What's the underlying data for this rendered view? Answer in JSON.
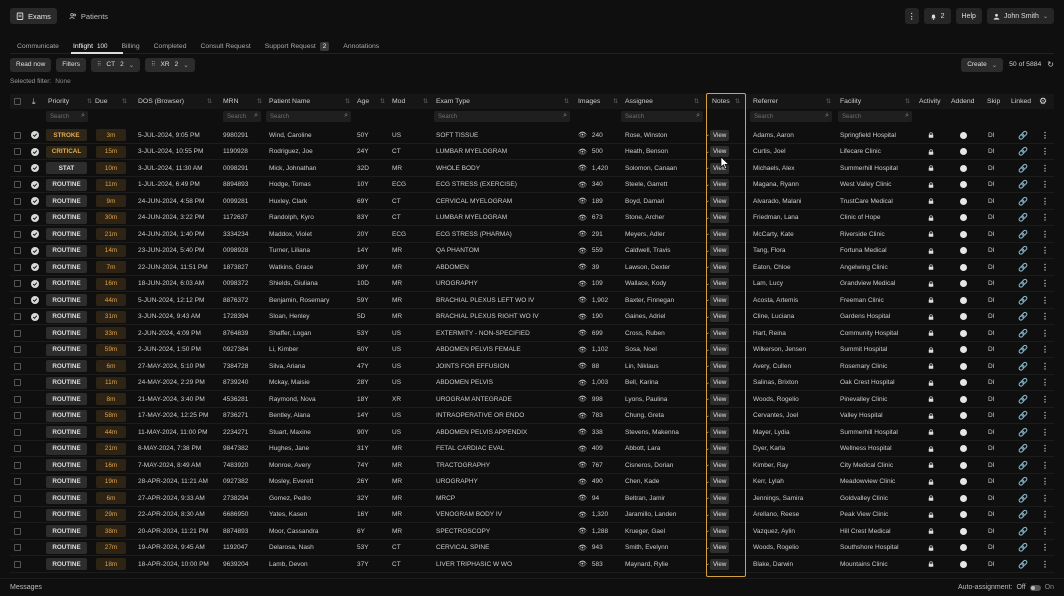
{
  "nav": {
    "exams": "Exams",
    "patients": "Patients",
    "notifications": "2",
    "help": "Help",
    "user": "John Smith"
  },
  "tabs": [
    {
      "label": "Communicate",
      "count": ""
    },
    {
      "label": "Inflight",
      "count": "100"
    },
    {
      "label": "Billing",
      "count": ""
    },
    {
      "label": "Completed",
      "count": ""
    },
    {
      "label": "Consult Request",
      "count": ""
    },
    {
      "label": "Support Request",
      "count": "2"
    },
    {
      "label": "Annotations",
      "count": ""
    }
  ],
  "filters": {
    "read_now": "Read now",
    "filters": "Filters",
    "chip1_label": "CT",
    "chip1_count": "2",
    "chip2_label": "XR",
    "chip2_count": "2",
    "create": "Create",
    "count_text": "50 of 5884",
    "selected_filter_label": "Selected filter:",
    "selected_filter_value": "None"
  },
  "columns": {
    "priority": "Priority",
    "due": "Due",
    "dos": "DOS (Browser)",
    "mrn": "MRN",
    "patient": "Patient Name",
    "age": "Age",
    "mod": "Mod",
    "exam": "Exam Type",
    "images": "Images",
    "assignee": "Assignee",
    "notes": "Notes",
    "referrer": "Referrer",
    "facility": "Facility",
    "activity": "Activity",
    "addend": "Addend",
    "skip": "Skip",
    "linked": "Linked",
    "search": "Search"
  },
  "view_label": "View",
  "skip_label": "DI",
  "rows": [
    {
      "checked": true,
      "priority": "STROKE",
      "due": "3m",
      "dos": "5-JUL-2024, 9:05 PM",
      "mrn": "9980291",
      "patient": "Wind, Caroline",
      "age": "50Y",
      "mod": "US",
      "exam": "SOFT TISSUE",
      "images": "240",
      "assignee": "Rose, Winston",
      "referrer": "Adams, Aaron",
      "facility": "Springfield Hospital"
    },
    {
      "checked": true,
      "priority": "CRITICAL",
      "due": "15m",
      "dos": "3-JUL-2024, 10:55 PM",
      "mrn": "1190928",
      "patient": "Rodriguez, Joe",
      "age": "24Y",
      "mod": "CT",
      "exam": "LUMBAR MYELOGRAM",
      "images": "500",
      "assignee": "Heath, Benson",
      "referrer": "Curtis, Joel",
      "facility": "Lifecare Clinic"
    },
    {
      "checked": true,
      "priority": "STAT",
      "due": "10m",
      "dos": "3-JUL-2024, 11:30 AM",
      "mrn": "0098291",
      "patient": "Mick, Johnathan",
      "age": "32D",
      "mod": "MR",
      "exam": "WHOLE BODY",
      "images": "1,420",
      "assignee": "Solomon, Canaan",
      "referrer": "Michaels, Alex",
      "facility": "Summerhill Hospital"
    },
    {
      "checked": true,
      "priority": "ROUTINE",
      "due": "11m",
      "dos": "1-JUL-2024, 6:49 PM",
      "mrn": "8894893",
      "patient": "Hodge, Tomas",
      "age": "10Y",
      "mod": "ECG",
      "exam": "ECG STRESS (EXERCISE)",
      "images": "340",
      "assignee": "Steele, Garrett",
      "referrer": "Magana, Ryann",
      "facility": "West Valley Clinic"
    },
    {
      "checked": true,
      "priority": "ROUTINE",
      "due": "9m",
      "dos": "24-JUN-2024, 4:58 PM",
      "mrn": "0099281",
      "patient": "Huxley, Clark",
      "age": "69Y",
      "mod": "CT",
      "exam": "CERVICAL MYELOGRAM",
      "images": "189",
      "assignee": "Boyd, Damari",
      "referrer": "Alvarado, Malani",
      "facility": "TrustCare Medical"
    },
    {
      "checked": true,
      "priority": "ROUTINE",
      "due": "30m",
      "dos": "24-JUN-2024, 3:22 PM",
      "mrn": "1172637",
      "patient": "Randolph, Kyro",
      "age": "83Y",
      "mod": "CT",
      "exam": "LUMBAR MYELOGRAM",
      "images": "673",
      "assignee": "Stone, Archer",
      "referrer": "Friedman, Lana",
      "facility": "Clinic of Hope"
    },
    {
      "checked": true,
      "priority": "ROUTINE",
      "due": "21m",
      "dos": "24-JUN-2024, 1:40 PM",
      "mrn": "3334234",
      "patient": "Maddox, Violet",
      "age": "20Y",
      "mod": "ECG",
      "exam": "ECG STRESS (PHARMA)",
      "images": "291",
      "assignee": "Meyers, Adler",
      "referrer": "McCarty, Kate",
      "facility": "Riverside Clinic"
    },
    {
      "checked": true,
      "priority": "ROUTINE",
      "due": "14m",
      "dos": "23-JUN-2024, 5:40 PM",
      "mrn": "0098928",
      "patient": "Turner, Liliana",
      "age": "14Y",
      "mod": "MR",
      "exam": "QA PHANTOM",
      "images": "559",
      "assignee": "Caldwell, Travis",
      "referrer": "Tang, Flora",
      "facility": "Fortuna Medical"
    },
    {
      "checked": true,
      "priority": "ROUTINE",
      "due": "7m",
      "dos": "22-JUN-2024, 11:51 PM",
      "mrn": "1873827",
      "patient": "Watkins, Grace",
      "age": "39Y",
      "mod": "MR",
      "exam": "ABDOMEN",
      "images": "39",
      "assignee": "Lawson, Dexter",
      "referrer": "Eaton, Chloe",
      "facility": "Angelwing Clinic"
    },
    {
      "checked": true,
      "priority": "ROUTINE",
      "due": "16m",
      "dos": "18-JUN-2024, 6:03 AM",
      "mrn": "0098372",
      "patient": "Shields, Giuliana",
      "age": "10D",
      "mod": "MR",
      "exam": "UROGRAPHY",
      "images": "109",
      "assignee": "Wallace, Kody",
      "referrer": "Lam, Lucy",
      "facility": "Grandview Medical"
    },
    {
      "checked": true,
      "priority": "ROUTINE",
      "due": "44m",
      "dos": "5-JUN-2024, 12:12 PM",
      "mrn": "8876372",
      "patient": "Benjamin, Rosemary",
      "age": "59Y",
      "mod": "MR",
      "exam": "BRACHIAL PLEXUS LEFT WO IV",
      "images": "1,902",
      "assignee": "Baxter, Finnegan",
      "referrer": "Acosta, Artemis",
      "facility": "Freeman Clinic"
    },
    {
      "checked": true,
      "priority": "ROUTINE",
      "due": "31m",
      "dos": "3-JUN-2024, 9:43 AM",
      "mrn": "1728394",
      "patient": "Sloan, Henley",
      "age": "5D",
      "mod": "MR",
      "exam": "BRACHIAL PLEXUS RIGHT WO IV",
      "images": "190",
      "assignee": "Gaines, Adriel",
      "referrer": "Cline, Luciana",
      "facility": "Gardens Hospital"
    },
    {
      "checked": false,
      "priority": "ROUTINE",
      "due": "33m",
      "dos": "2-JUN-2024, 4:09 PM",
      "mrn": "8764839",
      "patient": "Shaffer, Logan",
      "age": "53Y",
      "mod": "US",
      "exam": "EXTERMITY - NON-SPECIFIED",
      "images": "699",
      "assignee": "Cross, Ruben",
      "referrer": "Hart, Reina",
      "facility": "Community Hospital"
    },
    {
      "checked": false,
      "priority": "ROUTINE",
      "due": "59m",
      "dos": "2-JUN-2024, 1:50 PM",
      "mrn": "0927384",
      "patient": "Li, Kimber",
      "age": "60Y",
      "mod": "US",
      "exam": "ABDOMEN PELVIS FEMALE",
      "images": "1,102",
      "assignee": "Sosa, Noel",
      "referrer": "Wilkerson, Jensen",
      "facility": "Summit Hospital"
    },
    {
      "checked": false,
      "priority": "ROUTINE",
      "due": "6m",
      "dos": "27-MAY-2024, 5:10 PM",
      "mrn": "7384728",
      "patient": "Silva, Ariana",
      "age": "47Y",
      "mod": "US",
      "exam": "JOINTS FOR EFFUSION",
      "images": "88",
      "assignee": "Lin, Niklaus",
      "referrer": "Avery, Cullen",
      "facility": "Rosemary Clinic"
    },
    {
      "checked": false,
      "priority": "ROUTINE",
      "due": "11m",
      "dos": "24-MAY-2024, 2:29 PM",
      "mrn": "8739240",
      "patient": "Mckay, Maisie",
      "age": "28Y",
      "mod": "US",
      "exam": "ABDOMEN PELVIS",
      "images": "1,003",
      "assignee": "Bell, Karina",
      "referrer": "Salinas, Brixton",
      "facility": "Oak Crest Hospital"
    },
    {
      "checked": false,
      "priority": "ROUTINE",
      "due": "8m",
      "dos": "21-MAY-2024, 3:40 PM",
      "mrn": "4536281",
      "patient": "Raymond, Nova",
      "age": "18Y",
      "mod": "XR",
      "exam": "UROGRAM ANTEGRADE",
      "images": "998",
      "assignee": "Lyons, Paulina",
      "referrer": "Woods, Rogelio",
      "facility": "Pinevalley Clinic"
    },
    {
      "checked": false,
      "priority": "ROUTINE",
      "due": "58m",
      "dos": "17-MAY-2024, 12:25 PM",
      "mrn": "8736271",
      "patient": "Bentley, Alana",
      "age": "14Y",
      "mod": "US",
      "exam": "INTRAOPERATIVE OR ENDO",
      "images": "783",
      "assignee": "Chung, Greta",
      "referrer": "Cervantes, Joel",
      "facility": "Valley Hospital"
    },
    {
      "checked": false,
      "priority": "ROUTINE",
      "due": "44m",
      "dos": "11-MAY-2024, 11:00 PM",
      "mrn": "2234271",
      "patient": "Stuart, Maxine",
      "age": "90Y",
      "mod": "US",
      "exam": "ABDOMEN PELVIS APPENDIX",
      "images": "338",
      "assignee": "Stevens, Makenna",
      "referrer": "Mayer, Lydia",
      "facility": "Summerhill Hospital"
    },
    {
      "checked": false,
      "priority": "ROUTINE",
      "due": "21m",
      "dos": "8-MAY-2024, 7:38 PM",
      "mrn": "9847382",
      "patient": "Hughes, Jane",
      "age": "31Y",
      "mod": "MR",
      "exam": "FETAL CARDIAC EVAL",
      "images": "409",
      "assignee": "Abbott, Lara",
      "referrer": "Dyer, Karla",
      "facility": "Wellness Hospital"
    },
    {
      "checked": false,
      "priority": "ROUTINE",
      "due": "16m",
      "dos": "7-MAY-2024, 8:49 AM",
      "mrn": "7483920",
      "patient": "Monroe, Avery",
      "age": "74Y",
      "mod": "MR",
      "exam": "TRACTOGRAPHY",
      "images": "767",
      "assignee": "Cisneros, Dorian",
      "referrer": "Kimber, Ray",
      "facility": "City Medical Clinic"
    },
    {
      "checked": false,
      "priority": "ROUTINE",
      "due": "19m",
      "dos": "28-APR-2024, 11:21 AM",
      "mrn": "0927382",
      "patient": "Mosley, Everett",
      "age": "26Y",
      "mod": "MR",
      "exam": "UROGRAPHY",
      "images": "490",
      "assignee": "Chen, Kade",
      "referrer": "Kerr, Lylah",
      "facility": "Meadowview Clinic"
    },
    {
      "checked": false,
      "priority": "ROUTINE",
      "due": "6m",
      "dos": "27-APR-2024, 9:33 AM",
      "mrn": "2738294",
      "patient": "Gomez, Pedro",
      "age": "32Y",
      "mod": "MR",
      "exam": "MRCP",
      "images": "94",
      "assignee": "Beltran, Jamir",
      "referrer": "Jennings, Samira",
      "facility": "Goldvalley Clinic"
    },
    {
      "checked": false,
      "priority": "ROUTINE",
      "due": "29m",
      "dos": "22-APR-2024, 8:30 AM",
      "mrn": "6686950",
      "patient": "Yates, Kasen",
      "age": "16Y",
      "mod": "MR",
      "exam": "VENOGRAM BODY IV",
      "images": "1,320",
      "assignee": "Jaramillo, Landen",
      "referrer": "Arellano, Reese",
      "facility": "Peak View Clinic"
    },
    {
      "checked": false,
      "priority": "ROUTINE",
      "due": "38m",
      "dos": "20-APR-2024, 11:21 PM",
      "mrn": "8874893",
      "patient": "Moor, Cassandra",
      "age": "6Y",
      "mod": "MR",
      "exam": "SPECTROSCOPY",
      "images": "1,288",
      "assignee": "Krueger, Gael",
      "referrer": "Vazquez, Aylin",
      "facility": "Hill Crest Medical"
    },
    {
      "checked": false,
      "priority": "ROUTINE",
      "due": "27m",
      "dos": "19-APR-2024, 9:45 AM",
      "mrn": "1192047",
      "patient": "Delarosa, Nash",
      "age": "53Y",
      "mod": "CT",
      "exam": "CERVICAL SPINE",
      "images": "943",
      "assignee": "Smith, Evelynn",
      "referrer": "Woods, Rogelio",
      "facility": "Southshore Hospital"
    },
    {
      "checked": false,
      "priority": "ROUTINE",
      "due": "18m",
      "dos": "18-APR-2024, 10:00 PM",
      "mrn": "9639204",
      "patient": "Lamb, Devon",
      "age": "37Y",
      "mod": "CT",
      "exam": "LIVER TRIPHASIC W WO",
      "images": "583",
      "assignee": "Maynard, Rylie",
      "referrer": "Blake, Darwin",
      "facility": "Mountains Clinic"
    }
  ],
  "footer": {
    "messages": "Messages",
    "auto_assignment": "Auto-assignment:",
    "off": "Off",
    "on": "On"
  }
}
